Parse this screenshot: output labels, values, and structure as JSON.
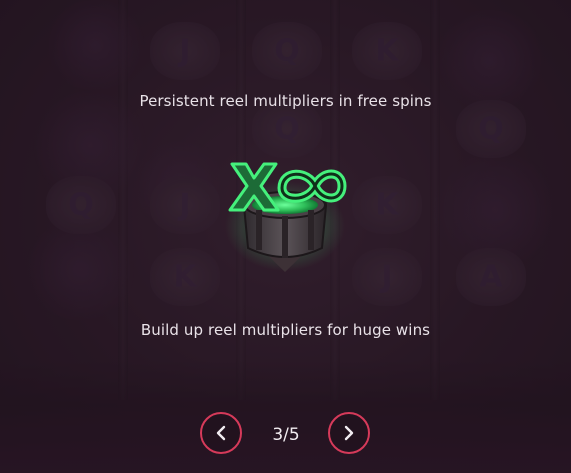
{
  "screen": {
    "title_text": "Persistent reel multipliers in free spins",
    "description_text": "Build up reel multipliers for huge wins",
    "feature_icon": "infinity-multiplier-icon",
    "feature_symbol": "X∞"
  },
  "navigation": {
    "previous_icon": "chevron-left-icon",
    "next_icon": "chevron-right-icon",
    "page_indicator": "3/5",
    "current_page": 3,
    "total_pages": 5
  },
  "colors": {
    "accent": "#d63a5a",
    "multiplier_green": "#37d86a",
    "text": "#e9e2e8",
    "background": "#2b1a27"
  }
}
